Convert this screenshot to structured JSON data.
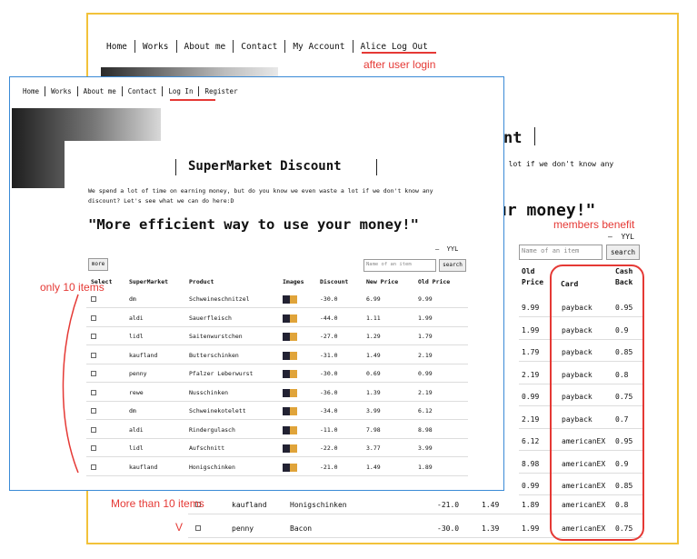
{
  "member_page": {
    "nav": [
      "Home",
      "Works",
      "About me",
      "Contact",
      "My Account",
      "Alice Log Out"
    ],
    "title_fragment": "nt",
    "intro_fragment": "a lot if we don't know any",
    "slogan_fragment": "ur money!\"",
    "currency": "YYL",
    "search_placeholder": "Name of an item",
    "search_button": "search",
    "headers": {
      "old_price": "Old Price",
      "card": "Card",
      "cash_back": "Cash Back"
    },
    "rows": [
      {
        "old_price": "9.99",
        "card": "payback",
        "cash_back": "0.95"
      },
      {
        "old_price": "1.99",
        "card": "payback",
        "cash_back": "0.9"
      },
      {
        "old_price": "1.79",
        "card": "payback",
        "cash_back": "0.85"
      },
      {
        "old_price": "2.19",
        "card": "payback",
        "cash_back": "0.8"
      },
      {
        "old_price": "0.99",
        "card": "payback",
        "cash_back": "0.75"
      },
      {
        "old_price": "2.19",
        "card": "payback",
        "cash_back": "0.7"
      },
      {
        "old_price": "6.12",
        "card": "americanEX",
        "cash_back": "0.95"
      },
      {
        "old_price": "8.98",
        "card": "americanEX",
        "cash_back": "0.9"
      },
      {
        "old_price": "0.99",
        "card": "americanEX",
        "cash_back": "0.85"
      }
    ],
    "extra_rows": [
      {
        "supermarket": "kaufland",
        "product": "Honigschinken",
        "discount": "-21.0",
        "new_price": "1.49",
        "old_price": "1.89",
        "card": "americanEX",
        "cash_back": "0.8"
      },
      {
        "supermarket": "penny",
        "product": "Bacon",
        "discount": "-30.0",
        "new_price": "1.39",
        "old_price": "1.99",
        "card": "americanEX",
        "cash_back": "0.75"
      }
    ]
  },
  "guest_page": {
    "nav": [
      "Home",
      "Works",
      "About me",
      "Contact",
      "Log In",
      "Register"
    ],
    "title": "SuperMarket Discount",
    "intro": "We spend a lot of time on earning money, but do you know we even waste a lot if we don't know any discount? Let's see what we can do here:D",
    "slogan": "\"More efficient way to use your money!\"",
    "currency": "YYL",
    "more_button": "more",
    "search_placeholder": "Name of an item",
    "search_button": "search",
    "headers": [
      "Select",
      "SuperMarket",
      "Product",
      "Images",
      "Discount",
      "New Price",
      "Old Price"
    ],
    "rows": [
      {
        "supermarket": "dm",
        "product": "Schweineschnitzel",
        "discount": "-30.0",
        "new_price": "6.99",
        "old_price": "9.99"
      },
      {
        "supermarket": "aldi",
        "product": "Sauerfleisch",
        "discount": "-44.0",
        "new_price": "1.11",
        "old_price": "1.99"
      },
      {
        "supermarket": "lidl",
        "product": "Saitenwurstchen",
        "discount": "-27.0",
        "new_price": "1.29",
        "old_price": "1.79"
      },
      {
        "supermarket": "kaufland",
        "product": "Butterschinken",
        "discount": "-31.0",
        "new_price": "1.49",
        "old_price": "2.19"
      },
      {
        "supermarket": "penny",
        "product": "Pfalzer Leberwurst",
        "discount": "-30.0",
        "new_price": "0.69",
        "old_price": "0.99"
      },
      {
        "supermarket": "rewe",
        "product": "Nusschinken",
        "discount": "-36.0",
        "new_price": "1.39",
        "old_price": "2.19"
      },
      {
        "supermarket": "dm",
        "product": "Schweinekotelett",
        "discount": "-34.0",
        "new_price": "3.99",
        "old_price": "6.12"
      },
      {
        "supermarket": "aldi",
        "product": "Rindergulasch",
        "discount": "-11.0",
        "new_price": "7.98",
        "old_price": "8.98"
      },
      {
        "supermarket": "lidl",
        "product": "Aufschnitt",
        "discount": "-22.0",
        "new_price": "3.77",
        "old_price": "3.99"
      },
      {
        "supermarket": "kaufland",
        "product": "Honigschinken",
        "discount": "-21.0",
        "new_price": "1.49",
        "old_price": "1.89"
      }
    ]
  },
  "annotations": {
    "after_login": "after user login",
    "members_benefit": "members benefit",
    "only_10": "only 10 items",
    "more_than_10": "More than 10 items",
    "v_mark": "V"
  }
}
